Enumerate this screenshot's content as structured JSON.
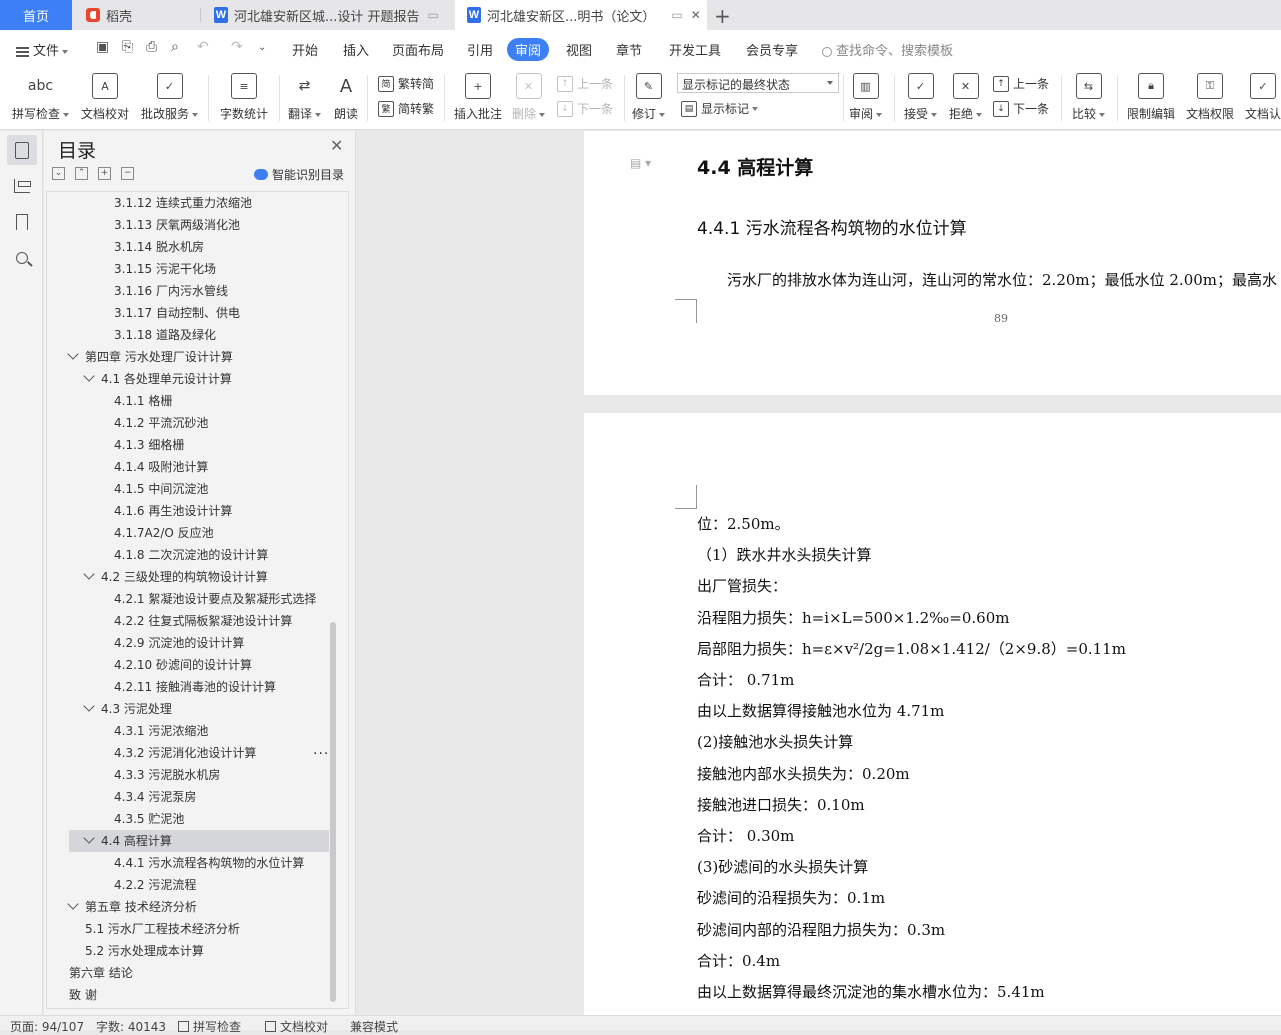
{
  "tabs": {
    "home": "首页",
    "daoke": "稻壳",
    "doc1": "河北雄安新区城...设计 开题报告",
    "doc2": "河北雄安新区...明书（论文）",
    "new_tab": "+"
  },
  "menu": {
    "file": "文件",
    "items": [
      "开始",
      "插入",
      "页面布局",
      "引用",
      "审阅",
      "视图",
      "章节",
      "开发工具",
      "会员专享"
    ],
    "active": "审阅",
    "search_placeholder": "查找命令、搜索模板"
  },
  "toolbar": {
    "spell_check": "拼写检查",
    "doc_proof": "文档校对",
    "annotate_service": "批改服务",
    "word_count": "字数统计",
    "translate": "翻译",
    "read_aloud": "朗读",
    "trad_simp": "繁转简",
    "simp_trad": "简转繁",
    "insert_comment": "插入批注",
    "delete": "删除",
    "prev": "上一条",
    "next": "下一条",
    "track": "修订",
    "markup_state": "显示标记的最终状态",
    "show_markup": "显示标记",
    "review": "审阅",
    "accept": "接受",
    "reject": "拒绝",
    "prev2": "上一条",
    "next2": "下一条",
    "compare": "比较",
    "restrict_edit": "限制编辑",
    "doc_permission": "文档权限",
    "doc_cert": "文档认"
  },
  "toc": {
    "title": "目录",
    "smart": "智能识别目录",
    "items": [
      {
        "label": "3.1.12 连续式重力浓缩池",
        "level": 3
      },
      {
        "label": "3.1.13 厌氧两级消化池",
        "level": 3
      },
      {
        "label": "3.1.14 脱水机房",
        "level": 3
      },
      {
        "label": "3.1.15 污泥干化场",
        "level": 3
      },
      {
        "label": "3.1.16  厂内污水管线",
        "level": 3
      },
      {
        "label": "3.1.17  自动控制、供电",
        "level": 3
      },
      {
        "label": "3.1.18  道路及绿化",
        "level": 3
      },
      {
        "label": "第四章 污水处理厂设计计算",
        "level": 1
      },
      {
        "label": "4.1 各处理单元设计计算",
        "level": 2
      },
      {
        "label": "4.1.1 格栅",
        "level": 3
      },
      {
        "label": "4.1.2 平流沉砂池",
        "level": 3
      },
      {
        "label": "4.1.3 细格栅",
        "level": 3
      },
      {
        "label": "4.1.4 吸附池计算",
        "level": 3
      },
      {
        "label": "4.1.5 中间沉淀池",
        "level": 3
      },
      {
        "label": "4.1.6 再生池设计计算",
        "level": 3
      },
      {
        "label": "4.1.7A2/O 反应池",
        "level": 3
      },
      {
        "label": "4.1.8 二次沉淀池的设计计算",
        "level": 3
      },
      {
        "label": "4.2 三级处理的构筑物设计计算",
        "level": 2
      },
      {
        "label": "4.2.1 絮凝池设计要点及絮凝形式选择",
        "level": 3
      },
      {
        "label": "4.2.2 往复式隔板絮凝池设计计算",
        "level": 3
      },
      {
        "label": "4.2.9  沉淀池的设计计算",
        "level": 3
      },
      {
        "label": "4.2.10 砂滤间的设计计算",
        "level": 3
      },
      {
        "label": "4.2.11 接触消毒池的设计计算",
        "level": 3
      },
      {
        "label": "4.3 污泥处理",
        "level": 2
      },
      {
        "label": "4.3.1 污泥浓缩池",
        "level": 3
      },
      {
        "label": "4.3.2 污泥消化池设计计算",
        "level": 3
      },
      {
        "label": "4.3.3 污泥脱水机房",
        "level": 3
      },
      {
        "label": "4.3.4 污泥泵房",
        "level": 3
      },
      {
        "label": "4.3.5 贮泥池",
        "level": 3
      },
      {
        "label": "4.4 高程计算",
        "level": 2
      },
      {
        "label": "4.4.1 污水流程各构筑物的水位计算",
        "level": 3
      },
      {
        "label": "4.2.2 污泥流程",
        "level": 3
      },
      {
        "label": "第五章  技术经济分析",
        "level": 1
      },
      {
        "label": "5.1 污水厂工程技术经济分析",
        "level": 2
      },
      {
        "label": "5.2 污水处理成本计算",
        "level": 2
      },
      {
        "label": "第六章  结论",
        "level": 1
      },
      {
        "label": "致    谢",
        "level": 1
      }
    ],
    "selected_index": 29
  },
  "document": {
    "heading": "4.4 高程计算",
    "subheading": "4.4.1 污水流程各构筑物的水位计算",
    "paragraph1": "污水厂的排放水体为连山河，连山河的常水位：2.20m；最低水位 2.00m；最高水",
    "page_number": "89",
    "lines": [
      "位：2.50m。",
      "（1）跌水井水头损失计算",
      "出厂管损失：",
      "沿程阻力损失：h=i×L=500×1.2‰=0.60m",
      "局部阻力损失：h=ε×v²/2g=1.08×1.412/（2×9.8）=0.11m",
      "合计：  0.71m",
      "由以上数据算得接触池水位为 4.71m",
      "(2)接触池水头损失计算",
      "接触池内部水头损失为：0.20m",
      "接触池进口损失：0.10m",
      "合计：  0.30m",
      "(3)砂滤间的水头损失计算",
      "砂滤间的沿程损失为：0.1m",
      "砂滤间内部的沿程阻力损失为：0.3m",
      "合计：0.4m",
      "由以上数据算得最终沉淀池的集水槽水位为：5.41m"
    ]
  },
  "status": {
    "page": "页面: 94/107",
    "words": "字数: 40143",
    "spell": "拼写检查",
    "proof": "文档校对",
    "compat": "兼容模式"
  }
}
